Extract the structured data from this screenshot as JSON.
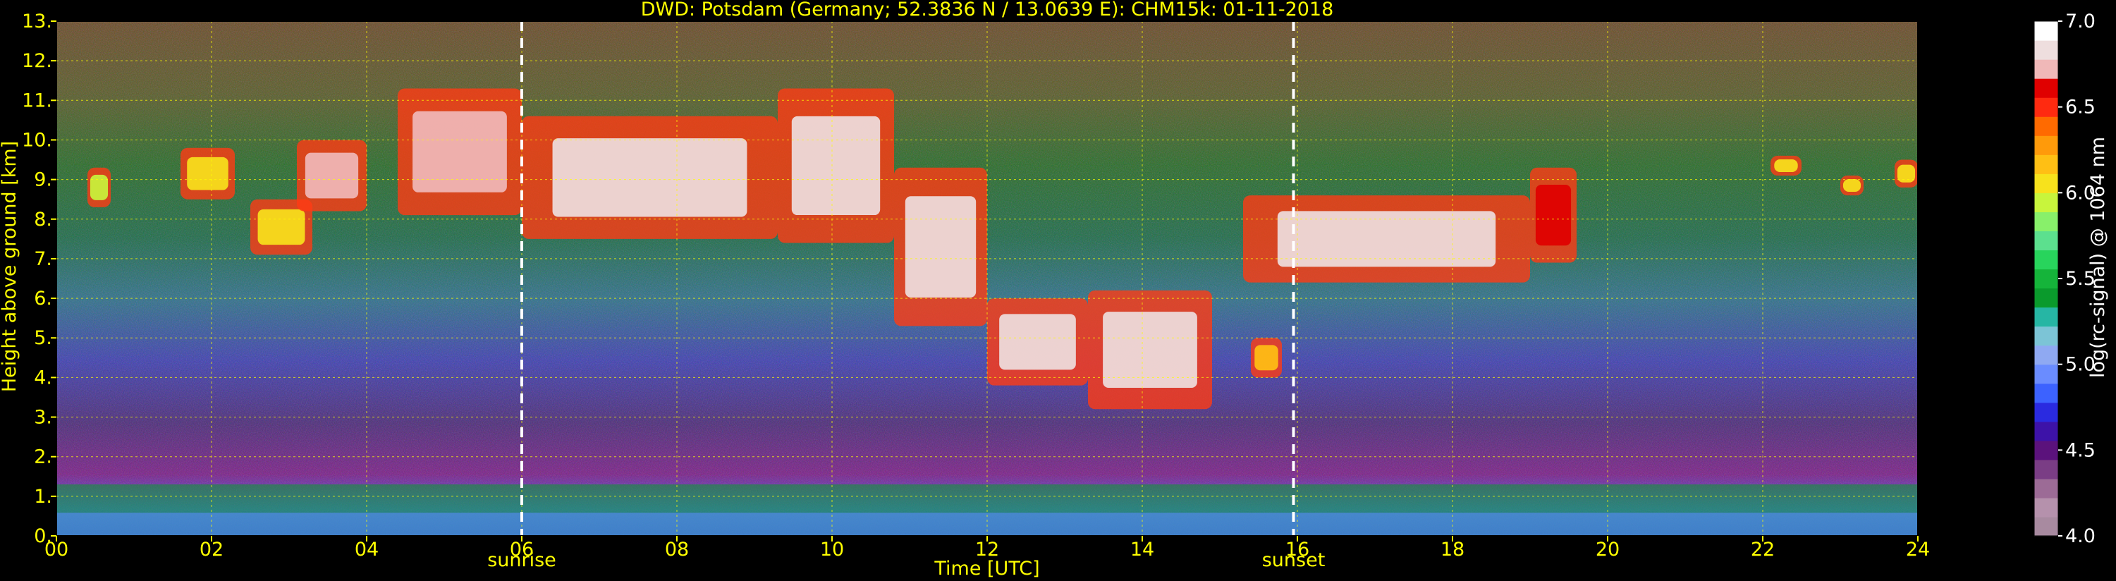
{
  "chart_data": {
    "type": "heatmap",
    "title": "DWD: Potsdam (Germany; 52.3836 N / 13.0639 E):    CHM15k: 01-11-2018",
    "xlabel": "Time [UTC]",
    "ylabel": "Height above ground [km]",
    "x_ticks": [
      "00",
      "02",
      "04",
      "06",
      "08",
      "10",
      "12",
      "14",
      "16",
      "18",
      "20",
      "22",
      "24"
    ],
    "y_ticks": [
      "0.",
      "1.",
      "2.",
      "3.",
      "4.",
      "5.",
      "6.",
      "7.",
      "8.",
      "9.",
      "10.",
      "11.",
      "12.",
      "13."
    ],
    "xlim": [
      0,
      24
    ],
    "ylim": [
      0,
      13
    ],
    "grid": true,
    "event_markers": [
      {
        "label": "sunrise",
        "time_utc": 6.0
      },
      {
        "label": "sunset",
        "time_utc": 15.95
      }
    ],
    "colorbar": {
      "label": "log(rc-signal) @ 1064 nm",
      "ticks": [
        "4.0",
        "4.5",
        "5.0",
        "5.5",
        "6.0",
        "6.5",
        "7.0"
      ],
      "range": [
        4.0,
        7.0
      ],
      "colors": [
        "#a88aa0",
        "#b591ac",
        "#9c6b96",
        "#7a3d85",
        "#5b127c",
        "#3d12a8",
        "#2a2ae0",
        "#3c62ff",
        "#6a8cff",
        "#8fa9f2",
        "#7cc4d6",
        "#26b6a4",
        "#0a9a2c",
        "#15b43a",
        "#28d45c",
        "#5ce08e",
        "#88f06a",
        "#c8f53c",
        "#f7e21c",
        "#ffbf14",
        "#ff9a0a",
        "#ff6a00",
        "#ff2a10",
        "#e00000",
        "#f0b8b8",
        "#eedede",
        "#ffffff"
      ]
    },
    "cloud_layers": [
      {
        "t_start": 0.4,
        "t_end": 0.7,
        "base_km": 8.3,
        "top_km": 9.3,
        "intensity": 6.0
      },
      {
        "t_start": 1.6,
        "t_end": 2.3,
        "base_km": 8.5,
        "top_km": 9.8,
        "intensity": 6.1
      },
      {
        "t_start": 2.5,
        "t_end": 3.3,
        "base_km": 7.1,
        "top_km": 8.5,
        "intensity": 6.1
      },
      {
        "t_start": 3.1,
        "t_end": 4.0,
        "base_km": 8.2,
        "top_km": 10.0,
        "intensity": 6.8
      },
      {
        "t_start": 4.4,
        "t_end": 6.0,
        "base_km": 8.1,
        "top_km": 11.3,
        "intensity": 6.8
      },
      {
        "t_start": 6.0,
        "t_end": 9.3,
        "base_km": 7.5,
        "top_km": 10.6,
        "intensity": 6.9
      },
      {
        "t_start": 9.3,
        "t_end": 10.8,
        "base_km": 7.4,
        "top_km": 11.3,
        "intensity": 6.9
      },
      {
        "t_start": 10.8,
        "t_end": 12.0,
        "base_km": 5.3,
        "top_km": 9.3,
        "intensity": 6.9
      },
      {
        "t_start": 12.0,
        "t_end": 13.3,
        "base_km": 3.8,
        "top_km": 6.0,
        "intensity": 6.9
      },
      {
        "t_start": 13.3,
        "t_end": 14.9,
        "base_km": 3.2,
        "top_km": 6.2,
        "intensity": 6.9
      },
      {
        "t_start": 15.4,
        "t_end": 15.8,
        "base_km": 4.0,
        "top_km": 5.0,
        "intensity": 6.2
      },
      {
        "t_start": 15.3,
        "t_end": 19.0,
        "base_km": 6.4,
        "top_km": 8.6,
        "intensity": 6.9
      },
      {
        "t_start": 19.0,
        "t_end": 19.6,
        "base_km": 6.9,
        "top_km": 9.3,
        "intensity": 6.6
      },
      {
        "t_start": 22.1,
        "t_end": 22.5,
        "base_km": 9.1,
        "top_km": 9.6,
        "intensity": 6.1
      },
      {
        "t_start": 23.0,
        "t_end": 23.3,
        "base_km": 8.6,
        "top_km": 9.1,
        "intensity": 6.1
      },
      {
        "t_start": 23.7,
        "t_end": 24.0,
        "base_km": 8.8,
        "top_km": 9.5,
        "intensity": 6.1
      }
    ],
    "boundary_layer": {
      "base_km": 0.0,
      "top_km": 1.3,
      "intensity": 5.4
    }
  }
}
